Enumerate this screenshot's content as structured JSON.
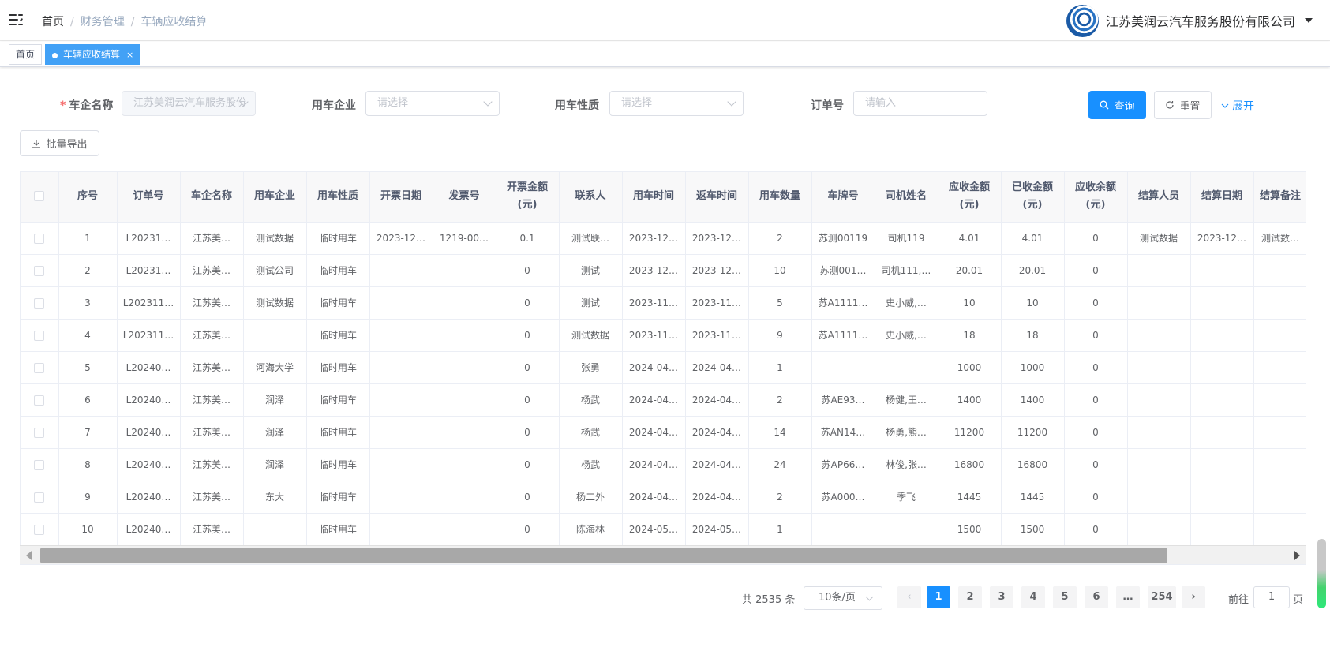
{
  "header": {
    "breadcrumbs": [
      "首页",
      "财务管理",
      "车辆应收结算"
    ],
    "company": "江苏美润云汽车服务股份有限公司"
  },
  "tags": [
    {
      "label": "首页"
    },
    {
      "label": "车辆应收结算",
      "close": "×"
    }
  ],
  "filters": {
    "company": {
      "label": "车企名称",
      "required": "*",
      "value": "江苏美润云汽车服务股份"
    },
    "use_company": {
      "label": "用车企业",
      "placeholder": "请选择"
    },
    "use_type": {
      "label": "用车性质",
      "placeholder": "请选择"
    },
    "order_no": {
      "label": "订单号",
      "placeholder": "请输入"
    }
  },
  "actions": {
    "query": "查询",
    "reset": "重置",
    "expand": "展开",
    "export": "批量导出"
  },
  "table": {
    "headers": [
      "序号",
      "订单号",
      "车企名称",
      "用车企业",
      "用车性质",
      "开票日期",
      "发票号",
      "开票金额(元)",
      "联系人",
      "用车时间",
      "返车时间",
      "用车数量",
      "车牌号",
      "司机姓名",
      "应收金额(元)",
      "已收金额(元)",
      "应收余额(元)",
      "结算人员",
      "结算日期",
      "结算备注"
    ],
    "rows": [
      [
        "1",
        "L20231…",
        "江苏美…",
        "测试数据",
        "临时用车",
        "2023-12…",
        "1219-00…",
        "0.1",
        "测试联…",
        "2023-12…",
        "2023-12…",
        "2",
        "苏测00119",
        "司机119",
        "4.01",
        "4.01",
        "0",
        "测试数据",
        "2023-12…",
        "测试数…"
      ],
      [
        "2",
        "L20231…",
        "江苏美…",
        "测试公司",
        "临时用车",
        "",
        "",
        "0",
        "测试",
        "2023-12…",
        "2023-12…",
        "10",
        "苏测001…",
        "司机111,…",
        "20.01",
        "20.01",
        "0",
        "",
        "",
        ""
      ],
      [
        "3",
        "L202311…",
        "江苏美…",
        "测试数据",
        "临时用车",
        "",
        "",
        "0",
        "测试",
        "2023-11…",
        "2023-11…",
        "5",
        "苏A1111…",
        "史小威,…",
        "10",
        "10",
        "0",
        "",
        "",
        ""
      ],
      [
        "4",
        "L202311…",
        "江苏美…",
        "",
        "临时用车",
        "",
        "",
        "0",
        "测试数据",
        "2023-11…",
        "2023-11…",
        "9",
        "苏A1111…",
        "史小威,…",
        "18",
        "18",
        "0",
        "",
        "",
        ""
      ],
      [
        "5",
        "L20240…",
        "江苏美…",
        "河海大学",
        "临时用车",
        "",
        "",
        "0",
        "张勇",
        "2024-04…",
        "2024-04…",
        "1",
        "",
        "",
        "1000",
        "1000",
        "0",
        "",
        "",
        ""
      ],
      [
        "6",
        "L20240…",
        "江苏美…",
        "润泽",
        "临时用车",
        "",
        "",
        "0",
        "杨武",
        "2024-04…",
        "2024-04…",
        "2",
        "苏AE93…",
        "杨健,王…",
        "1400",
        "1400",
        "0",
        "",
        "",
        ""
      ],
      [
        "7",
        "L20240…",
        "江苏美…",
        "润泽",
        "临时用车",
        "",
        "",
        "0",
        "杨武",
        "2024-04…",
        "2024-04…",
        "14",
        "苏AN14…",
        "杨勇,熊…",
        "11200",
        "11200",
        "0",
        "",
        "",
        ""
      ],
      [
        "8",
        "L20240…",
        "江苏美…",
        "润泽",
        "临时用车",
        "",
        "",
        "0",
        "杨武",
        "2024-04…",
        "2024-04…",
        "24",
        "苏AP66…",
        "林俊,张…",
        "16800",
        "16800",
        "0",
        "",
        "",
        ""
      ],
      [
        "9",
        "L20240…",
        "江苏美…",
        "东大",
        "临时用车",
        "",
        "",
        "0",
        "杨二外",
        "2024-04…",
        "2024-04…",
        "2",
        "苏A000…",
        "季飞",
        "1445",
        "1445",
        "0",
        "",
        "",
        ""
      ],
      [
        "10",
        "L20240…",
        "江苏美…",
        "",
        "临时用车",
        "",
        "",
        "0",
        "陈海林",
        "2024-05…",
        "2024-05…",
        "1",
        "",
        "",
        "1500",
        "1500",
        "0",
        "",
        "",
        ""
      ]
    ]
  },
  "pagination": {
    "total": "共 2535 条",
    "page_size": "10条/页",
    "pages": [
      "1",
      "2",
      "3",
      "4",
      "5",
      "6",
      "…",
      "254"
    ],
    "current": "1",
    "goto_prefix": "前往",
    "goto_value": "1",
    "goto_suffix": "页"
  }
}
